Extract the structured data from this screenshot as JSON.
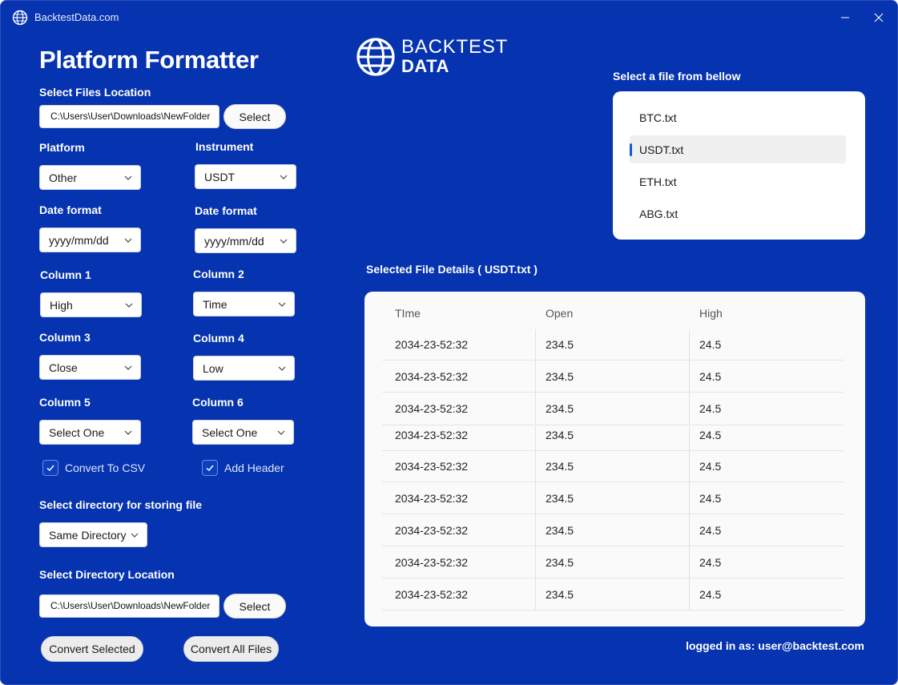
{
  "window": {
    "title": "BacktestData.com"
  },
  "page_title": "Platform Formatter",
  "files_location": {
    "label": "Select Files Location",
    "path": "C:\\Users\\User\\Downloads\\NewFolder",
    "button": "Select"
  },
  "platform": {
    "label": "Platform",
    "value": "Other"
  },
  "instrument": {
    "label": "Instrument",
    "value": "USDT"
  },
  "date_format_left": {
    "label": "Date format",
    "value": "yyyy/mm/dd"
  },
  "date_format_right": {
    "label": "Date format",
    "value": "yyyy/mm/dd"
  },
  "columns": [
    {
      "label": "Column 1",
      "value": "High"
    },
    {
      "label": "Column 2",
      "value": "Time"
    },
    {
      "label": "Column 3",
      "value": "Close"
    },
    {
      "label": "Column 4",
      "value": "Low"
    },
    {
      "label": "Column 5",
      "value": "Select One"
    },
    {
      "label": "Column 6",
      "value": "Select One"
    }
  ],
  "options": {
    "convert_csv": "Convert To CSV",
    "add_header": "Add Header"
  },
  "store_directory": {
    "label": "Select directory for storing file",
    "value": "Same Directory"
  },
  "directory_location": {
    "label": "Select Directory Location",
    "path": "C:\\Users\\User\\Downloads\\NewFolder",
    "button": "Select"
  },
  "actions": {
    "convert_selected": "Convert Selected",
    "convert_all": "Convert All Files"
  },
  "logo": {
    "line1": "BACKTEST",
    "line2": "DATA"
  },
  "file_list": {
    "label": "Select a file from bellow",
    "files": [
      "BTC.txt",
      "USDT.txt",
      "ETH.txt",
      "ABG.txt"
    ],
    "selected": "USDT.txt"
  },
  "details": {
    "label": "Selected File Details ( USDT.txt )",
    "headers": [
      "TIme",
      "Open",
      "High"
    ],
    "rows": [
      [
        "2034-23-52:32",
        "234.5",
        "24.5"
      ],
      [
        "2034-23-52:32",
        "234.5",
        "24.5"
      ],
      [
        "2034-23-52:32",
        "234.5",
        "24.5"
      ],
      [
        "2034-23-52:32",
        "234.5",
        "24.5"
      ],
      [
        "2034-23-52:32",
        "234.5",
        "24.5"
      ],
      [
        "2034-23-52:32",
        "234.5",
        "24.5"
      ],
      [
        "2034-23-52:32",
        "234.5",
        "24.5"
      ],
      [
        "2034-23-52:32",
        "234.5",
        "24.5"
      ],
      [
        "2034-23-52:32",
        "234.5",
        "24.5"
      ]
    ]
  },
  "footer": {
    "logged_in": "logged in as: user@backtest.com"
  },
  "colors": {
    "background": "#0633b0",
    "accent": "#0b5cd6"
  }
}
